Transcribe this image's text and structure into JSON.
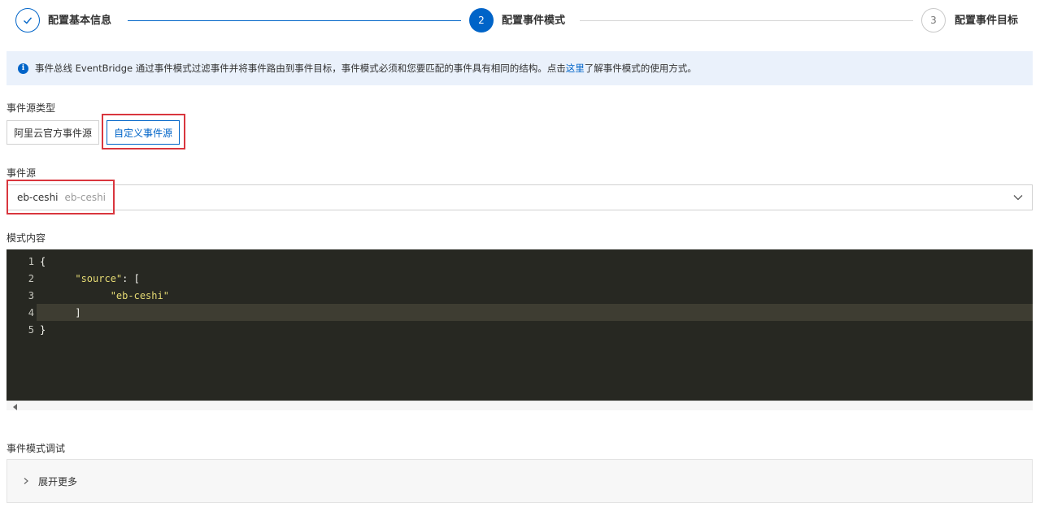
{
  "stepper": {
    "steps": [
      {
        "label": "配置基本信息",
        "state": "done",
        "marker": "✓"
      },
      {
        "label": "配置事件模式",
        "state": "active",
        "marker": "2"
      },
      {
        "label": "配置事件目标",
        "state": "todo",
        "marker": "3"
      }
    ]
  },
  "banner": {
    "text_before": "事件总线 EventBridge 通过事件模式过滤事件并将事件路由到事件目标，事件模式必须和您要匹配的事件具有相同的结构。点击",
    "link": "这里",
    "text_after": "了解事件模式的使用方式。",
    "icon": "info-icon"
  },
  "source_type": {
    "label": "事件源类型",
    "options": [
      "阿里云官方事件源",
      "自定义事件源"
    ],
    "selected": "自定义事件源"
  },
  "event_source": {
    "label": "事件源",
    "value": "eb-ceshi",
    "sub_value": "eb-ceshi",
    "icon": "chevron-down-icon"
  },
  "pattern": {
    "label": "模式内容",
    "lines": [
      {
        "num": "1",
        "text": "{"
      },
      {
        "num": "2",
        "indent": "      ",
        "str": "\"source\"",
        "rest": ": ["
      },
      {
        "num": "3",
        "indent": "            ",
        "str": "\"eb-ceshi\"",
        "rest": ""
      },
      {
        "num": "4",
        "text": "      ]"
      },
      {
        "num": "5",
        "text": "}"
      }
    ],
    "highlighted_line": 4
  },
  "debug": {
    "label": "事件模式调试",
    "expand_label": "展开更多",
    "icon": "chevron-right-icon"
  },
  "colors": {
    "accent": "#0064c8",
    "highlight_border": "#d9363e",
    "editor_bg": "#272822",
    "string": "#e6db74"
  }
}
